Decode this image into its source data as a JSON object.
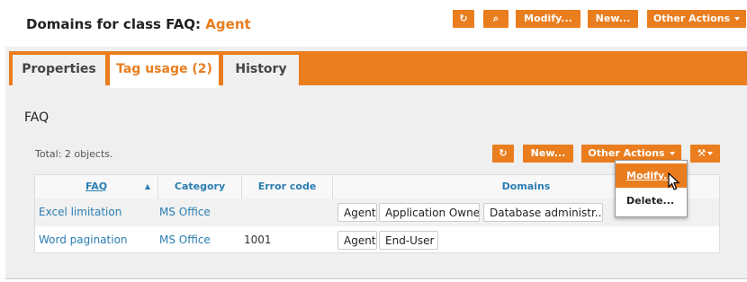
{
  "header": {
    "title_prefix": "Domains for class FAQ:",
    "title_object": "Agent",
    "buttons": {
      "refresh_icon": "refresh-icon",
      "search_icon": "search-icon",
      "modify": "Modify...",
      "new": "New...",
      "other_actions": "Other Actions"
    }
  },
  "tabs": [
    {
      "label": "Properties"
    },
    {
      "label": "Tag usage (2)"
    },
    {
      "label": "History"
    }
  ],
  "section": {
    "title": "FAQ",
    "total": "Total: 2 objects.",
    "toolbar": {
      "new": "New...",
      "other_actions": "Other Actions",
      "menu": [
        "Modify...",
        "Delete..."
      ]
    }
  },
  "table": {
    "columns": [
      "FAQ",
      "Category",
      "Error code",
      "Domains"
    ],
    "rows": [
      {
        "faq": "Excel limitation",
        "category": "MS Office",
        "error_code": "",
        "domains": [
          "Agent",
          "Application Owner",
          "Database administr..."
        ]
      },
      {
        "faq": "Word pagination",
        "category": "MS Office",
        "error_code": "1001",
        "domains": [
          "Agent",
          "End-User"
        ]
      }
    ]
  },
  "colors": {
    "accent": "#ea7d1e",
    "link": "#2a7db1"
  }
}
